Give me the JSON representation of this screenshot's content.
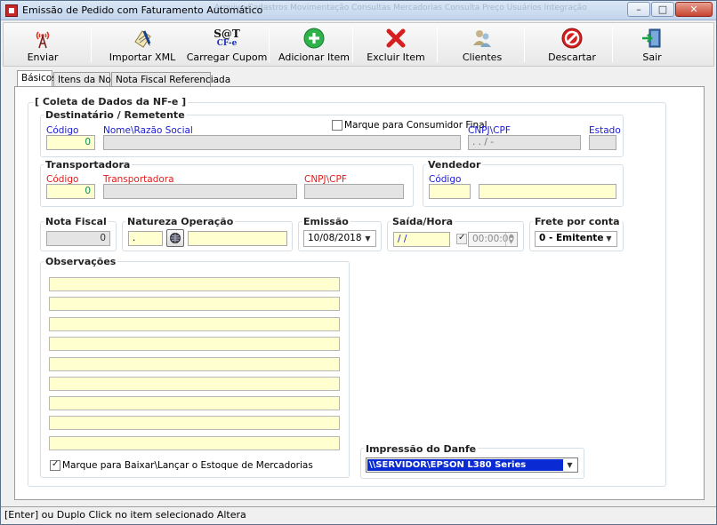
{
  "window": {
    "title": "Emissão de Pedido com Faturamento Automático",
    "ghost_menu": "Arquivo   Cadastros   Movimentação   Consultas   Mercadorias   Consulta Preço   Usuários   Integração"
  },
  "toolbar": {
    "enviar": "Enviar",
    "importar_xml": "Importar XML",
    "sat_logo_top": "S@T",
    "sat_logo_bottom": "CF-e",
    "carregar_cupom": "Carregar Cupom",
    "adicionar_item": "Adicionar Item",
    "excluir_item": "Excluir Item",
    "clientes": "Clientes",
    "descartar": "Descartar",
    "sair": "Sair"
  },
  "tabs": [
    "Básicos",
    "Itens da Nota",
    "Nota Fiscal Referenciada"
  ],
  "form": {
    "section_title": "[ Coleta de Dados da NF-e ]",
    "destinatario": {
      "group": "Destinatário / Remetente",
      "consumidor_final": "Marque para Consumidor Final",
      "codigo_label": "Código",
      "codigo_value": "0",
      "nome_label": "Nome\\Razão Social",
      "nome_value": "",
      "cnpj_label": "CNPJ\\CPF",
      "cnpj_value": "   .    .    /    -",
      "estado_label": "Estado",
      "estado_value": ""
    },
    "transportadora": {
      "group": "Transportadora",
      "codigo_label": "Código",
      "codigo_value": "0",
      "nome_label": "Transportadora",
      "nome_value": "",
      "cnpj_label": "CNPJ\\CPF",
      "cnpj_value": ""
    },
    "vendedor": {
      "group": "Vendedor",
      "codigo_label": "Código",
      "codigo_value": "",
      "nome_value": ""
    },
    "nota_fiscal": {
      "group": "Nota Fiscal",
      "value": "0"
    },
    "natureza": {
      "group": "Natureza Operação",
      "codigo_value": ".",
      "descricao_value": ""
    },
    "emissao": {
      "group": "Emissão",
      "value": "10/08/2018"
    },
    "saida": {
      "group": "Saída/Hora",
      "date_value": " /  /",
      "time_value": "00:00:00"
    },
    "frete": {
      "group": "Frete por conta",
      "value": "0 - Emitente"
    },
    "observacoes": {
      "group": "Observações",
      "baixar_estoque": "Marque para Baixar\\Lançar o Estoque de Mercadorias"
    },
    "danfe": {
      "group": "Impressão do Danfe",
      "printer": "\\\\SERVIDOR\\EPSON L380 Series"
    }
  },
  "status": {
    "text": "[Enter] ou Duplo Click no item selecionado Altera"
  },
  "colors": {
    "field_yellow": "#ffffd0",
    "label_blue": "#1a1ad6",
    "label_red": "#e21b1b",
    "selected_blue": "#0a2bd3"
  }
}
